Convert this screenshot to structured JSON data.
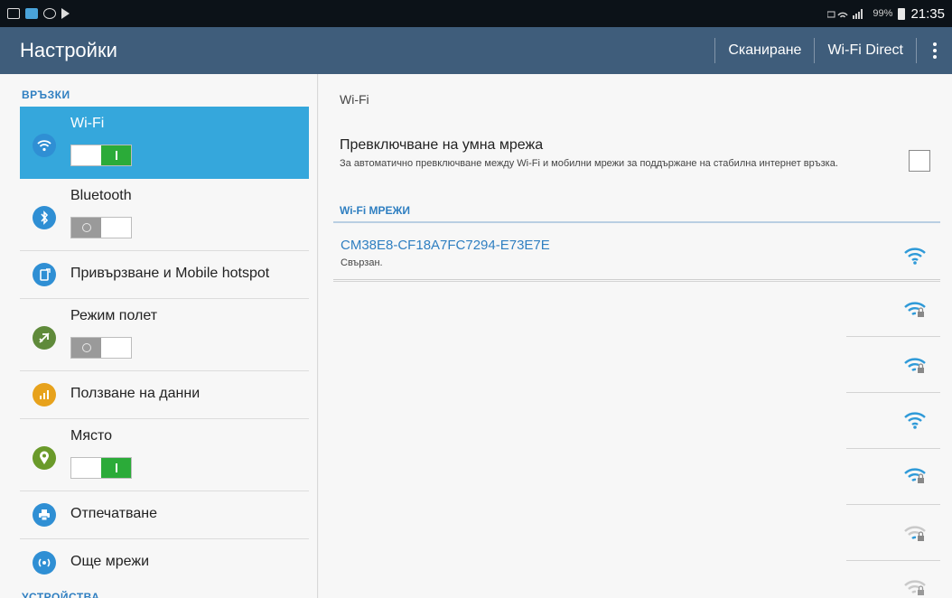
{
  "status_bar": {
    "right_text": "99%",
    "time": "21:35"
  },
  "action_bar": {
    "title": "Настройки",
    "scan_label": "Сканиране",
    "wifi_direct_label": "Wi-Fi Direct"
  },
  "sidebar": {
    "section_connections": "ВРЪЗКИ",
    "section_devices": "УСТРОЙСТВА",
    "items": [
      {
        "label": "Wi-Fi",
        "icon": "wifi-icon",
        "color": "#2f8fd4",
        "toggle": "on",
        "selected": true
      },
      {
        "label": "Bluetooth",
        "icon": "bluetooth-icon",
        "color": "#2f8fd4",
        "toggle": "off"
      },
      {
        "label": "Привързване и Mobile hotspot",
        "icon": "hotspot-icon",
        "color": "#2f8fd4"
      },
      {
        "label": "Режим полет",
        "icon": "airplane-icon",
        "color": "#5f8a3a",
        "toggle": "off"
      },
      {
        "label": "Ползване на данни",
        "icon": "data-usage-icon",
        "color": "#e7a21c"
      },
      {
        "label": "Място",
        "icon": "location-icon",
        "color": "#6a9a2a",
        "toggle": "on"
      },
      {
        "label": "Отпечатване",
        "icon": "printer-icon",
        "color": "#2f8fd4"
      },
      {
        "label": "Още мрежи",
        "icon": "more-networks-icon",
        "color": "#2f8fd4"
      }
    ]
  },
  "main": {
    "heading": "Wi-Fi",
    "smart_switch": {
      "title": "Превключване на умна мрежа",
      "description": "За автоматично превключване между Wi-Fi и мобилни мрежи за поддържане на стабилна интернет връзка.",
      "checked": false
    },
    "networks_header": "Wi-Fi МРЕЖИ",
    "networks": [
      {
        "name": "CM38E8-CF18A7FC7294-E73E7E",
        "status": "Свързан.",
        "icon": "wifi-full-icon",
        "locked": false
      },
      {
        "icon": "wifi-locked-icon",
        "locked": true
      },
      {
        "icon": "wifi-locked-icon",
        "locked": true
      },
      {
        "icon": "wifi-full-icon",
        "locked": false
      },
      {
        "icon": "wifi-locked-icon",
        "locked": true
      },
      {
        "icon": "wifi-weak-locked-icon",
        "locked": true
      },
      {
        "icon": "wifi-weak-locked-icon",
        "locked": true
      }
    ]
  }
}
